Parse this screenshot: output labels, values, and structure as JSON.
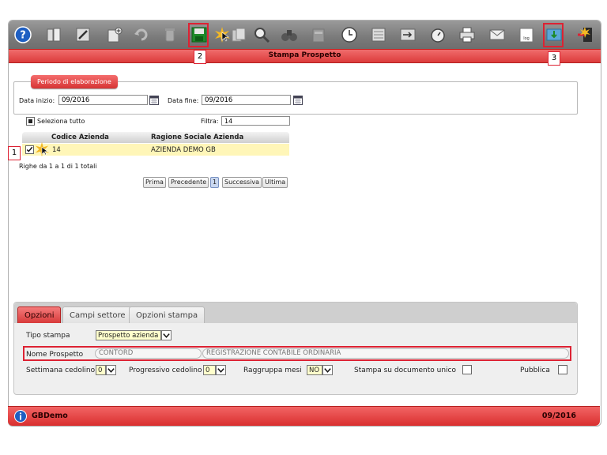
{
  "window": {
    "title": "Stampa Prospetto"
  },
  "toolbar": {
    "icons": [
      "help-icon",
      "book-icon",
      "pencil-icon",
      "new-doc-icon",
      "undo-icon",
      "trash-icon",
      "save-icon",
      "copy-icon",
      "search-icon",
      "binoculars-icon",
      "archive-icon",
      "clock-icon",
      "calculator-icon",
      "export-icon",
      "timer-icon",
      "printer-icon",
      "mail-icon",
      "log-icon",
      "import-icon",
      "exit-icon"
    ],
    "log_label": "log"
  },
  "callouts": {
    "c1": "1",
    "c2": "2",
    "c3": "3"
  },
  "periodo": {
    "legend": "Periodo di elaborazione",
    "start_label": "Data inizio:",
    "start_value": "09/2016",
    "end_label": "Data fine:",
    "end_value": "09/2016"
  },
  "selection": {
    "select_all_label": "Seleziona tutto",
    "filter_label": "Filtra:",
    "filter_value": "14"
  },
  "grid": {
    "columns": [
      "Codice Azienda",
      "Ragione Sociale Azienda"
    ],
    "rows": [
      {
        "codice": "14",
        "ragione": "AZIENDA DEMO GB",
        "checked": true
      }
    ],
    "summary": "Righe da 1 a 1 di 1 totali"
  },
  "pager": {
    "first": "Prima",
    "prev": "Precedente",
    "current": "1",
    "next": "Successiva",
    "last": "Ultima"
  },
  "tabs": [
    {
      "label": "Opzioni",
      "active": true
    },
    {
      "label": "Campi settore",
      "active": false
    },
    {
      "label": "Opzioni stampa",
      "active": false
    }
  ],
  "options": {
    "tipo_stampa_label": "Tipo stampa",
    "tipo_stampa_value": "Prospetto azienda",
    "nome_prospetto_label": "Nome Prospetto",
    "nome_prospetto_code": "CONTORD",
    "nome_prospetto_desc": "REGISTRAZIONE CONTABILE ORDINARIA",
    "settimana_label": "Settimana cedolino",
    "settimana_value": "0",
    "progressivo_label": "Progressivo cedolino",
    "progressivo_value": "0",
    "raggruppa_label": "Raggruppa mesi",
    "raggruppa_value": "NO",
    "stampa_unico_label": "Stampa su documento unico",
    "pubblica_label": "Pubblica"
  },
  "status": {
    "app_name": "GBDemo",
    "period": "09/2016"
  },
  "colors": {
    "accent": "#dc3b3b",
    "highlight_row": "#fff6b8",
    "toolbar": "#8a8a8a"
  }
}
